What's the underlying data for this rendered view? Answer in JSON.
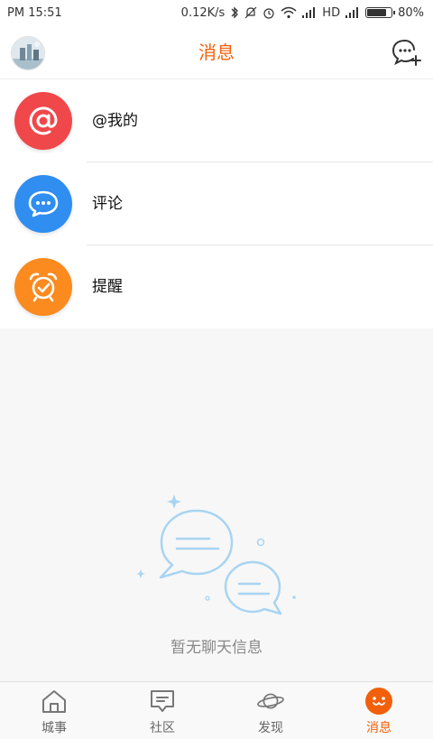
{
  "status_bar": {
    "time": "PM 15:51",
    "network_speed": "0.12K/s",
    "network_type": "HD",
    "battery": "80%"
  },
  "header": {
    "title": "消息"
  },
  "menu": [
    {
      "label": "@我的",
      "color": "#f0474a",
      "icon": "at-icon"
    },
    {
      "label": "评论",
      "color": "#2f8ef0",
      "icon": "comment-icon"
    },
    {
      "label": "提醒",
      "color": "#fb8a1f",
      "icon": "alarm-clock-icon"
    }
  ],
  "empty_state": {
    "text": "暂无聊天信息"
  },
  "tabs": [
    {
      "label": "城事",
      "icon": "home-icon",
      "active": false
    },
    {
      "label": "社区",
      "icon": "community-icon",
      "active": false
    },
    {
      "label": "发现",
      "icon": "planet-icon",
      "active": false
    },
    {
      "label": "消息",
      "icon": "message-face-icon",
      "active": true
    }
  ],
  "colors": {
    "accent": "#f2600b"
  }
}
